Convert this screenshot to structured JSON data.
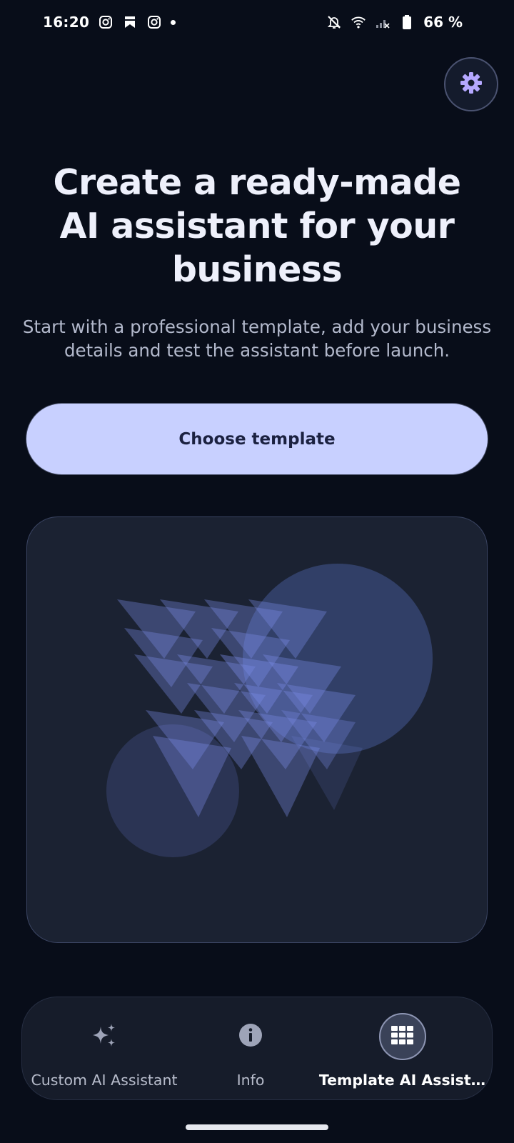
{
  "status_bar": {
    "time": "16:20",
    "battery": "66 %",
    "icons_left": [
      "instagram-icon",
      "bookmark-icon",
      "instagram-icon",
      "notification-dot"
    ],
    "icons_right": [
      "bell-off-icon",
      "wifi-icon",
      "signal-icon",
      "battery-icon"
    ]
  },
  "settings": {
    "icon": "gear-icon"
  },
  "hero": {
    "title": "Create a ready-made AI assistant for your business",
    "subtitle": "Start with a professional template, add your business details and test the assistant before launch."
  },
  "cta": {
    "label": "Choose template"
  },
  "bottom_nav": {
    "items": [
      {
        "label": "Custom AI Assistant",
        "icon": "sparkles-icon",
        "active": false
      },
      {
        "label": "Info",
        "icon": "info-icon",
        "active": false
      },
      {
        "label": "Template AI Assist…",
        "icon": "grid-icon",
        "active": true
      }
    ]
  },
  "colors": {
    "background": "#080d19",
    "accent": "#c8d0ff",
    "card": "#1b2232",
    "illustration": "#7b8ce8"
  }
}
